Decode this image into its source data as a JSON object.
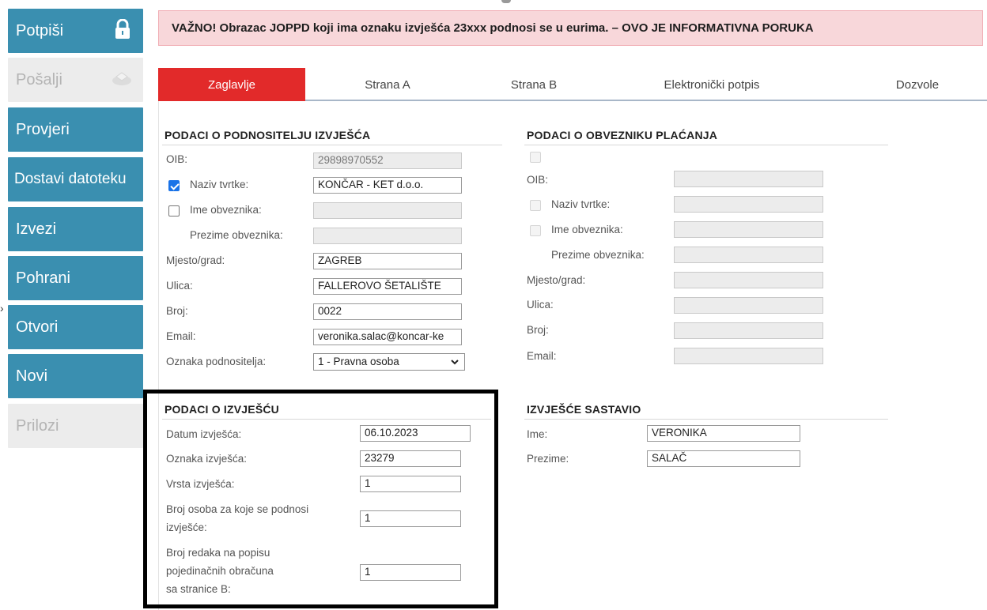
{
  "sidebar": {
    "potpisi": "Potpiši",
    "posalji": "Pošalji",
    "provjeri": "Provjeri",
    "dostavi": "Dostavi datoteku",
    "izvezi": "Izvezi",
    "pohrani": "Pohrani",
    "otvori": "Otvori",
    "novi": "Novi",
    "prilozi": "Prilozi"
  },
  "alert": "VAŽNO! Obrazac JOPPD koji ima oznaku izvješća 23xxx podnosi se u eurima. – OVO JE INFORMATIVNA PORUKA",
  "tabs": [
    "Zaglavlje",
    "Strana A",
    "Strana B",
    "Elektronički potpis",
    "Dozvole"
  ],
  "podnositelj": {
    "title": "PODACI O PODNOSITELJU IZVJEŠĆA",
    "oib_label": "OIB:",
    "oib": "29898970552",
    "naziv_label": "Naziv tvrtke:",
    "naziv": "KONČAR - KET d.o.o.",
    "ime_label": "Ime obveznika:",
    "ime": "",
    "prezime_label": "Prezime obveznika:",
    "prezime": "",
    "mjesto_label": "Mjesto/grad:",
    "mjesto": "ZAGREB",
    "ulica_label": "Ulica:",
    "ulica": "FALLEROVO ŠETALIŠTE",
    "broj_label": "Broj:",
    "broj": "0022",
    "email_label": "Email:",
    "email": "veronika.salac@koncar-ke",
    "oznaka_label": "Oznaka podnositelja:",
    "oznaka": "1 - Pravna osoba"
  },
  "obveznik": {
    "title": "PODACI O OBVEZNIKU PLAĆANJA",
    "oib_label": "OIB:",
    "naziv_label": "Naziv tvrtke:",
    "ime_label": "Ime obveznika:",
    "prezime_label": "Prezime obveznika:",
    "mjesto_label": "Mjesto/grad:",
    "ulica_label": "Ulica:",
    "broj_label": "Broj:",
    "email_label": "Email:"
  },
  "izvjesce": {
    "title": "PODACI O IZVJEŠĆU",
    "datum_label": "Datum izvješća:",
    "datum": "06.10.2023",
    "oznaka_label": "Oznaka izvješća:",
    "oznaka": "23279",
    "vrsta_label": "Vrsta izvješća:",
    "vrsta": "1",
    "broj_osoba_label_1": "Broj osoba za koje se podnosi",
    "broj_osoba_label_2": "izvješće:",
    "broj_osoba": "1",
    "broj_redaka_label_1": "Broj redaka na popisu",
    "broj_redaka_label_2": "pojedinačnih obračuna",
    "broj_redaka_label_3": "sa stranice B:",
    "broj_redaka": "1"
  },
  "sastavio": {
    "title": "IZVJEŠĆE SASTAVIO",
    "ime_label": "Ime:",
    "ime": "VERONIKA",
    "prezime_label": "Prezime:",
    "prezime": "SALAČ"
  },
  "colors": {
    "sidebar_button": "#3a8fb0",
    "active_tab": "#e22a2a",
    "alert_bg": "#f8d7da"
  }
}
